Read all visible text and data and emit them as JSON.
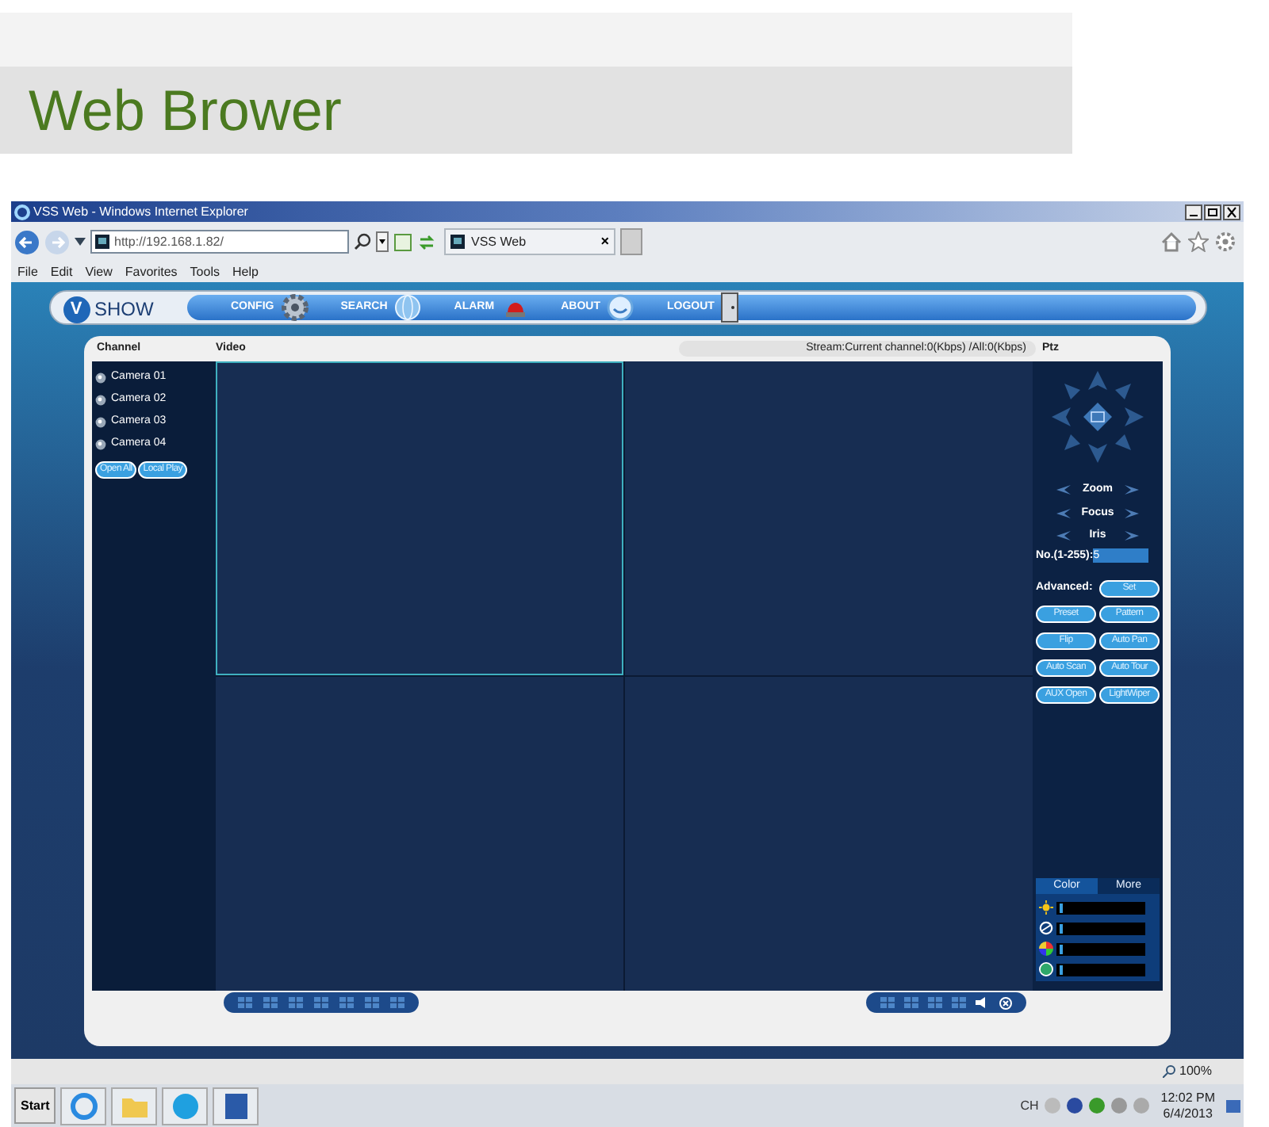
{
  "page_title": "Web Brower",
  "window": {
    "title": "VSS Web - Windows Internet Explorer"
  },
  "address_bar": {
    "value": "http://192.168.1.82/"
  },
  "browser_tab": {
    "label": "VSS Web",
    "close": "×"
  },
  "menu": [
    "File",
    "Edit",
    "View",
    "Favorites",
    "Tools",
    "Help"
  ],
  "app": {
    "logo_mark": "V",
    "logo": "SHOW",
    "nav": [
      {
        "label": "CONFIG",
        "kind": "gear"
      },
      {
        "label": "SEARCH",
        "kind": "globe"
      },
      {
        "label": "ALARM",
        "kind": "siren"
      },
      {
        "label": "ABOUT",
        "kind": "smile"
      },
      {
        "label": "LOGOUT",
        "kind": "door"
      }
    ]
  },
  "channel_panel": {
    "heading": "Channel",
    "cameras": [
      "Camera 01",
      "Camera 02",
      "Camera 03",
      "Camera 04"
    ],
    "buttons": [
      "Open All",
      "Local Play"
    ]
  },
  "video": {
    "heading": "Video",
    "stream": "Stream:Current channel:0(Kbps) /All:0(Kbps)",
    "cells": [
      {
        "selected": true
      },
      {
        "selected": false
      },
      {
        "selected": false
      },
      {
        "selected": false
      }
    ]
  },
  "ptz": {
    "heading": "Ptz",
    "lens": [
      "Zoom",
      "Focus",
      "Iris"
    ],
    "number_label": "No.(1-255):",
    "number_value": "5",
    "advanced_label": "Advanced:",
    "set_button": "Set",
    "buttons": [
      "Preset",
      "Pattern",
      "Flip",
      "Auto Pan",
      "Auto Scan",
      "Auto Tour",
      "AUX Open",
      "LightWiper"
    ]
  },
  "image_tabs": [
    {
      "label": "Color",
      "selected": true
    },
    {
      "label": "More",
      "selected": false
    }
  ],
  "image_sliders": [
    {
      "kind": "brightness",
      "level": 0.04
    },
    {
      "kind": "contrast",
      "level": 0.04
    },
    {
      "kind": "saturation",
      "level": 0.04
    },
    {
      "kind": "hue",
      "level": 0.04
    }
  ],
  "status_bar": {
    "zoom": "100%"
  },
  "taskbar": {
    "start": "Start",
    "language": "CH",
    "time": "12:02 PM",
    "date": "6/4/2013"
  }
}
